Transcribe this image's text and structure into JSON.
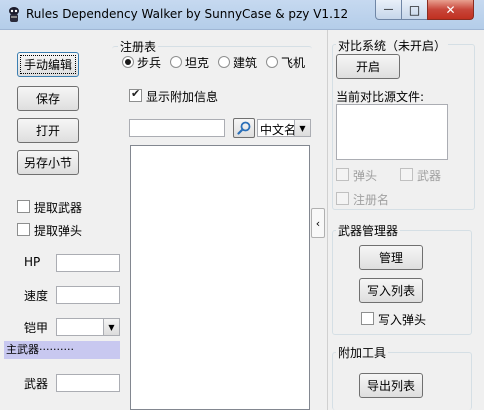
{
  "window": {
    "title": "Rules Dependency Walker by SunnyCase & pzy V1.12",
    "minimize_glyph": "—",
    "maximize_glyph": "□",
    "close_glyph": "✕"
  },
  "left": {
    "manual_edit_button": "手动编辑",
    "save_button": "保存",
    "open_button": "打开",
    "save_section_button": "另存小节",
    "extract_weapon_label": "提取武器",
    "extract_warhead_label": "提取弹头",
    "hp_label": "HP",
    "hp_value": "",
    "speed_label": "速度",
    "speed_value": "",
    "armor_label": "铠甲",
    "armor_value": "",
    "primary_weapon_section": "主武器··········",
    "weapon_label": "武器",
    "weapon_value": ""
  },
  "registry": {
    "title": "注册表",
    "options": [
      {
        "label": "步兵",
        "checked": true
      },
      {
        "label": "坦克",
        "checked": false
      },
      {
        "label": "建筑",
        "checked": false
      },
      {
        "label": "飞机",
        "checked": false
      }
    ],
    "show_extra_info_label": "显示附加信息",
    "show_extra_info_checked": true,
    "search_value": "",
    "language_selected": "中文名",
    "dropdown_glyph": "▼"
  },
  "splitter": {
    "glyph": "‹"
  },
  "compare": {
    "title": "对比系统（未开启）",
    "enable_button": "开启",
    "source_file_label": "当前对比源文件:",
    "source_file_value": "",
    "warhead_label": "弹头",
    "weapon_label": "武器",
    "registry_name_label": "注册名"
  },
  "weapon_manager": {
    "title": "武器管理器",
    "manage_button": "管理",
    "write_list_button": "写入列表",
    "write_warhead_label": "写入弹头"
  },
  "tools": {
    "title": "附加工具",
    "export_list_button": "导出列表"
  }
}
